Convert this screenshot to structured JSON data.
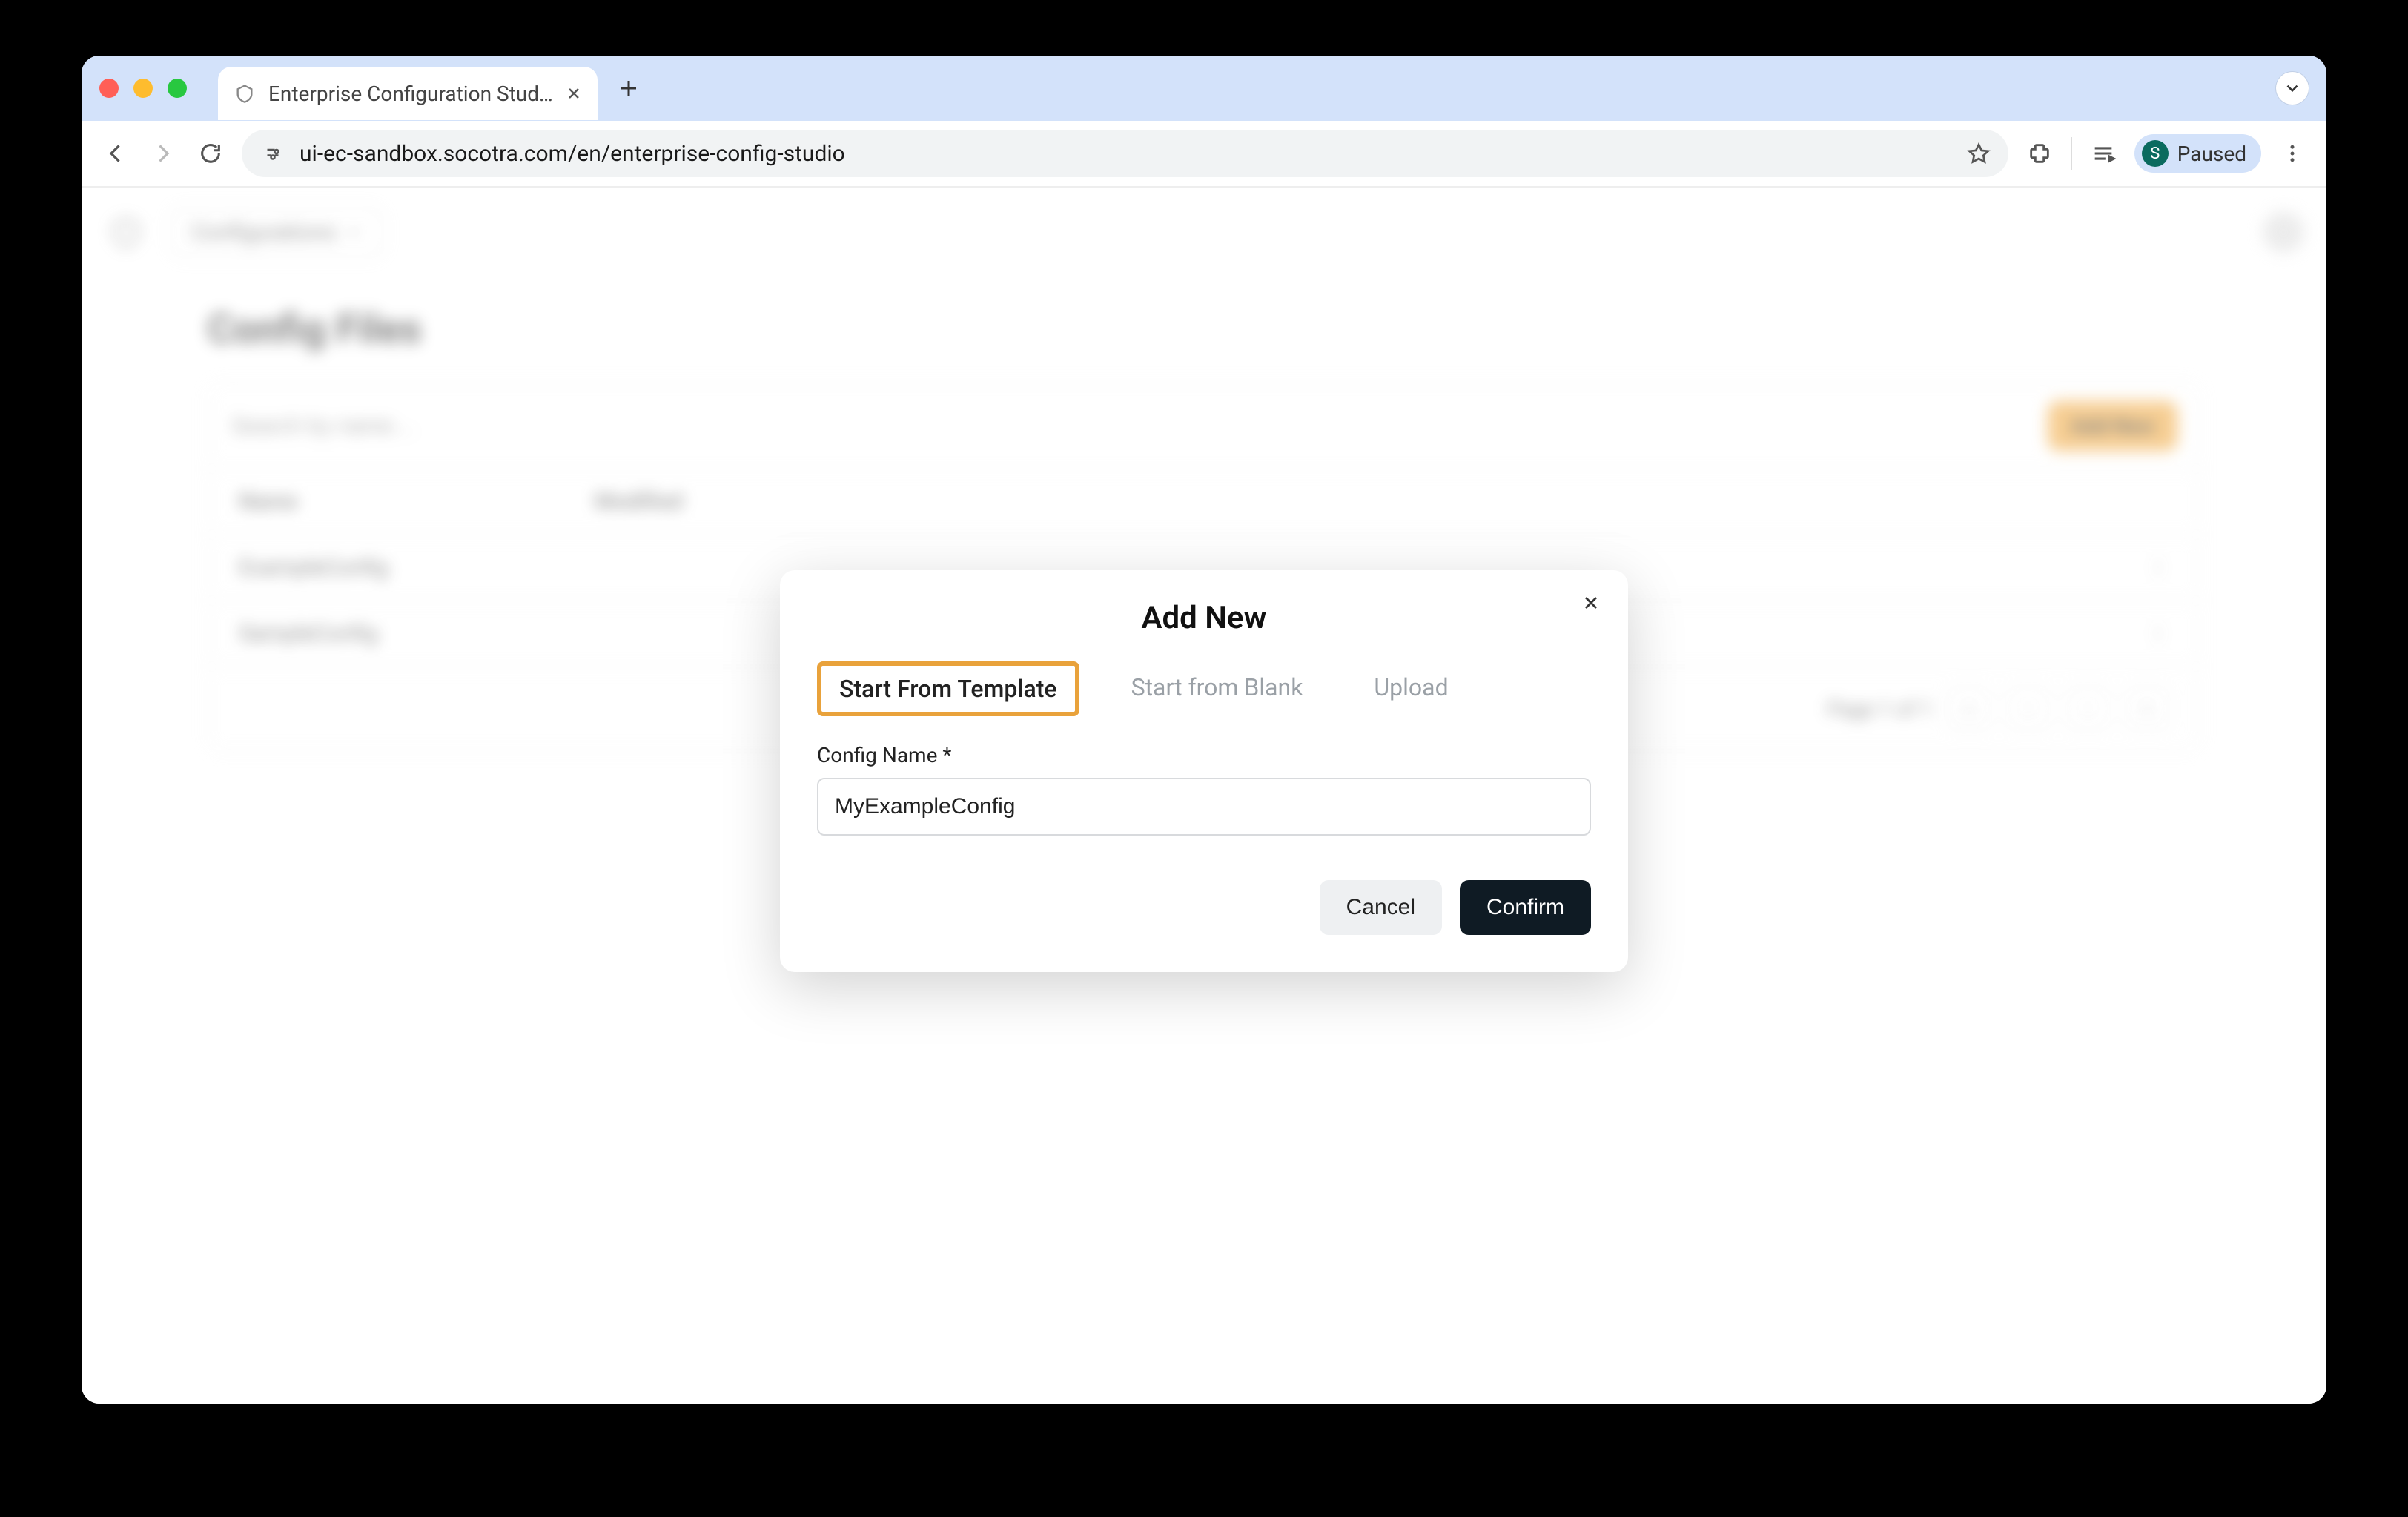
{
  "browser": {
    "tab_title": "Enterprise Configuration Stud…",
    "url": "ui-ec-sandbox.socotra.com/en/enterprise-config-studio",
    "profile_label": "Paused",
    "profile_initial": "S"
  },
  "app": {
    "nav_dropdown": "Configurations",
    "page_title": "Config Files",
    "search_placeholder": "Search by name…",
    "add_new_button": "Add New",
    "table": {
      "columns": [
        "Name",
        "Modified"
      ],
      "rows": [
        {
          "name": "ExampleConfig",
          "modified": ""
        },
        {
          "name": "SampleConfig",
          "modified": ""
        }
      ]
    },
    "pager": {
      "label": "Page 1 of 1"
    }
  },
  "modal": {
    "title": "Add New",
    "tabs": [
      "Start From Template",
      "Start from Blank",
      "Upload"
    ],
    "active_tab_index": 0,
    "field_label": "Config Name *",
    "config_name_value": "MyExampleConfig",
    "cancel_label": "Cancel",
    "confirm_label": "Confirm"
  }
}
